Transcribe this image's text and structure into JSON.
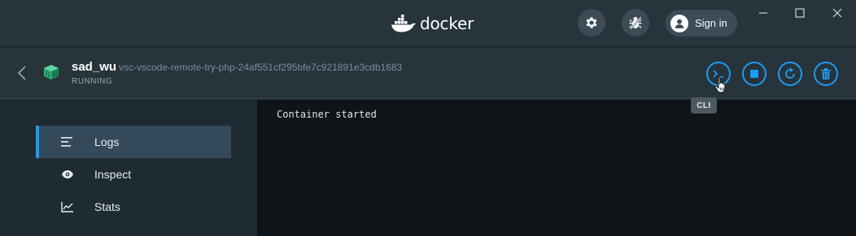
{
  "app": {
    "logo_text": "docker"
  },
  "titlebar": {
    "signin_label": "Sign in"
  },
  "container": {
    "name": "sad_wu",
    "id": "vsc-vscode-remote-try-php-24af551cf295bfe7c921891e3cdb1683",
    "status": "RUNNING"
  },
  "actions": {
    "tooltip": "CLI",
    "buttons": [
      "cli-icon",
      "stop-icon",
      "restart-icon",
      "delete-icon"
    ]
  },
  "sidebar": {
    "items": [
      {
        "label": "Logs",
        "icon": "logs-icon",
        "active": true
      },
      {
        "label": "Inspect",
        "icon": "eye-icon",
        "active": false
      },
      {
        "label": "Stats",
        "icon": "stats-icon",
        "active": false
      }
    ]
  },
  "logs": {
    "lines": [
      "Container started"
    ]
  },
  "colors": {
    "accent": "#1d9bf0",
    "titlebar": "#27343c",
    "sidebar": "#1f2b33",
    "log_bg": "#0f1418"
  }
}
